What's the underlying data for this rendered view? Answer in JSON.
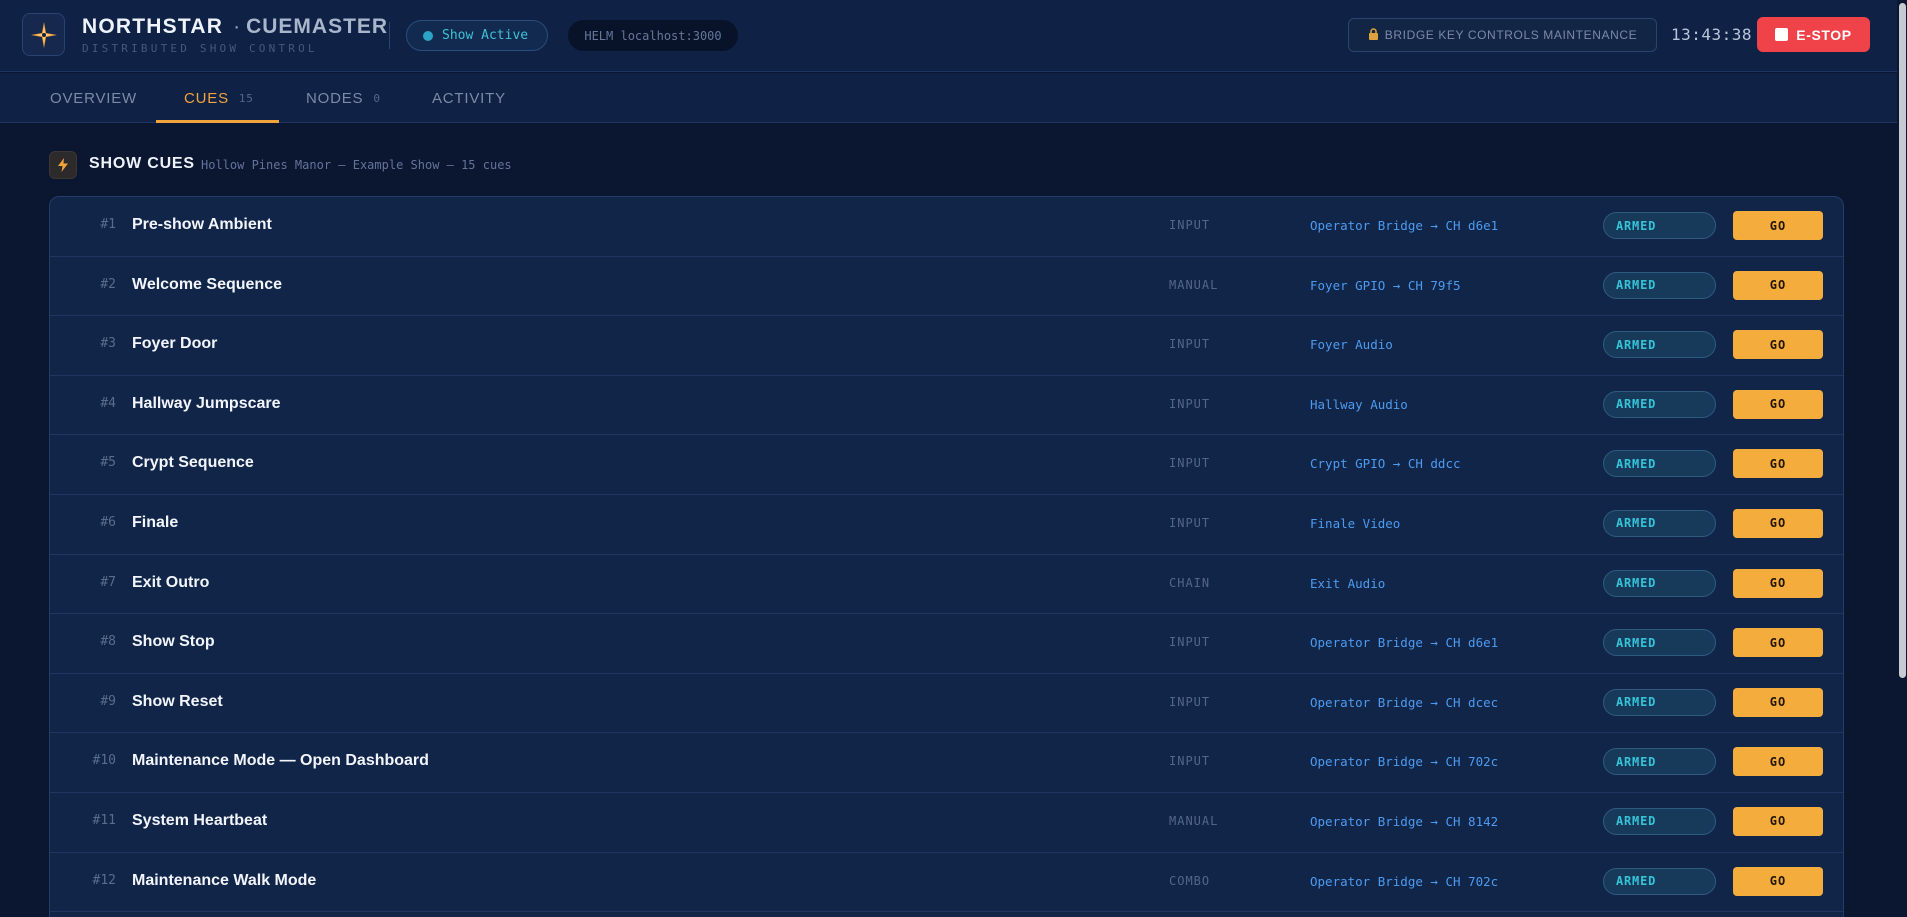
{
  "header": {
    "brand_name": "NORTHSTAR",
    "brand_sep": "·",
    "product": "CUEMASTER",
    "subtitle": "DISTRIBUTED SHOW CONTROL",
    "status_pill": "Show Active",
    "helm": "HELM localhost:3000",
    "maintenance_button": "BRIDGE KEY CONTROLS MAINTENANCE",
    "clock": "13:43:38",
    "estop_label": "E-STOP"
  },
  "tabs": [
    {
      "label": "OVERVIEW",
      "count": ""
    },
    {
      "label": "CUES",
      "count": "15"
    },
    {
      "label": "NODES",
      "count": "0"
    },
    {
      "label": "ACTIVITY",
      "count": ""
    }
  ],
  "section": {
    "title": "SHOW CUES",
    "subtitle": "Hollow Pines Manor — Example Show — 15 cues"
  },
  "cues": [
    {
      "num": "#1",
      "name": "Pre-show Ambient",
      "trigger": "INPUT",
      "target": "Operator Bridge → CH d6e1",
      "status": "ARMED",
      "action": "GO"
    },
    {
      "num": "#2",
      "name": "Welcome Sequence",
      "trigger": "MANUAL",
      "target": "Foyer GPIO → CH 79f5",
      "status": "ARMED",
      "action": "GO"
    },
    {
      "num": "#3",
      "name": "Foyer Door",
      "trigger": "INPUT",
      "target": "Foyer Audio",
      "status": "ARMED",
      "action": "GO"
    },
    {
      "num": "#4",
      "name": "Hallway Jumpscare",
      "trigger": "INPUT",
      "target": "Hallway Audio",
      "status": "ARMED",
      "action": "GO"
    },
    {
      "num": "#5",
      "name": "Crypt Sequence",
      "trigger": "INPUT",
      "target": "Crypt GPIO → CH ddcc",
      "status": "ARMED",
      "action": "GO"
    },
    {
      "num": "#6",
      "name": "Finale",
      "trigger": "INPUT",
      "target": "Finale Video",
      "status": "ARMED",
      "action": "GO"
    },
    {
      "num": "#7",
      "name": "Exit Outro",
      "trigger": "CHAIN",
      "target": "Exit Audio",
      "status": "ARMED",
      "action": "GO"
    },
    {
      "num": "#8",
      "name": "Show Stop",
      "trigger": "INPUT",
      "target": "Operator Bridge → CH d6e1",
      "status": "ARMED",
      "action": "GO"
    },
    {
      "num": "#9",
      "name": "Show Reset",
      "trigger": "INPUT",
      "target": "Operator Bridge → CH dcec",
      "status": "ARMED",
      "action": "GO"
    },
    {
      "num": "#10",
      "name": "Maintenance Mode — Open Dashboard",
      "trigger": "INPUT",
      "target": "Operator Bridge → CH 702c",
      "status": "ARMED",
      "action": "GO"
    },
    {
      "num": "#11",
      "name": "System Heartbeat",
      "trigger": "MANUAL",
      "target": "Operator Bridge → CH 8142",
      "status": "ARMED",
      "action": "GO"
    },
    {
      "num": "#12",
      "name": "Maintenance Walk Mode",
      "trigger": "COMBO",
      "target": "Operator Bridge → CH 702c",
      "status": "ARMED",
      "action": "GO"
    }
  ],
  "icons": {
    "logo": "compass-star-icon",
    "lock": "lock-icon",
    "section": "bolt-icon",
    "estop": "stop-square-icon"
  },
  "colors": {
    "accent": "#f2a33c",
    "estop": "#ef4349",
    "armed": "#35c3d8",
    "target_link": "#4d9bf0",
    "go_button": "#f4ad3d"
  }
}
